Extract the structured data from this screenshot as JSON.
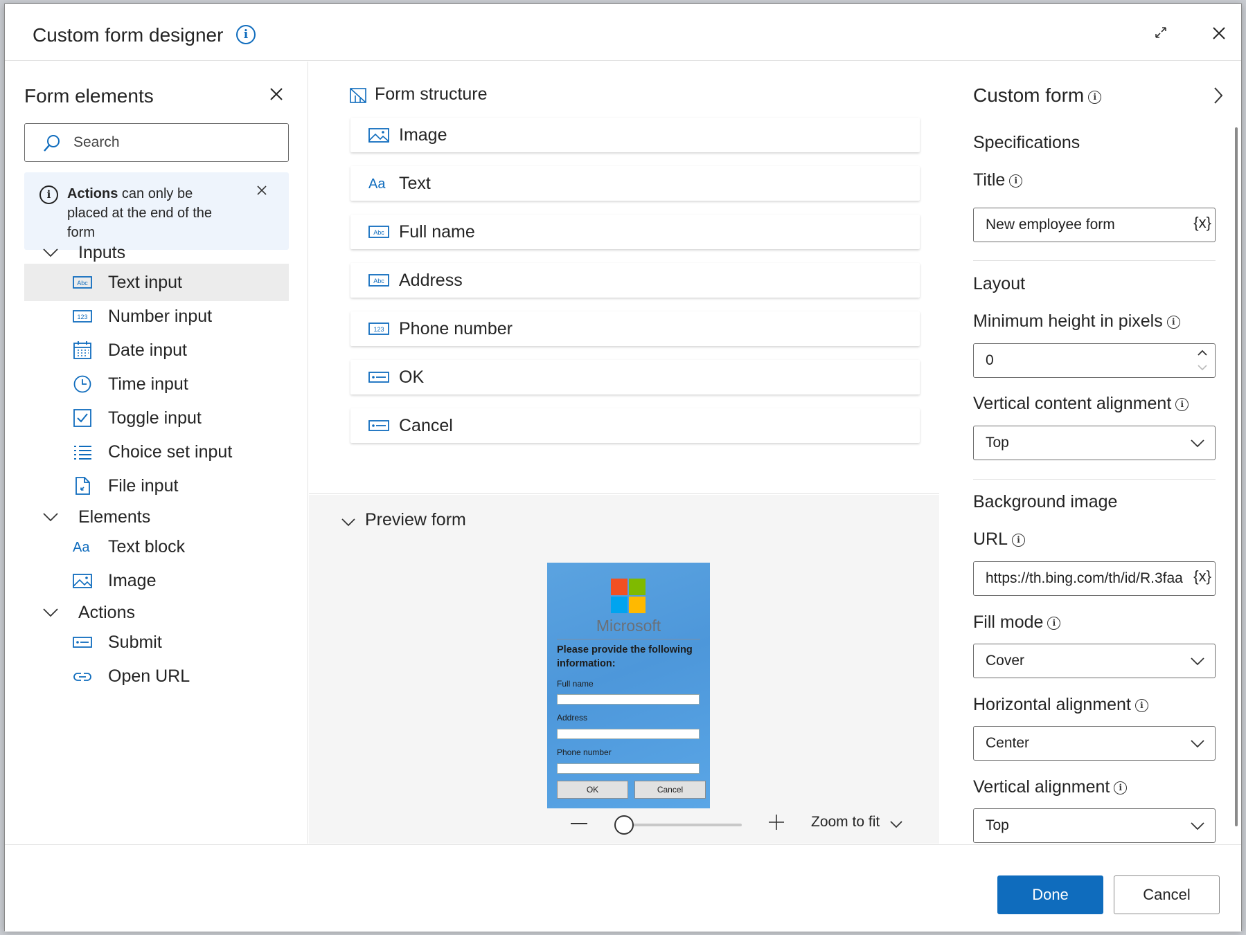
{
  "dialog": {
    "title": "Custom form designer",
    "expand_icon": "expand-icon",
    "close_icon": "close-icon"
  },
  "left_pane": {
    "title": "Form elements",
    "search_placeholder": "Search",
    "notice_bold": "Actions",
    "notice_rest": "can only be placed at the end of the form",
    "groups": {
      "inputs": {
        "label": "Inputs",
        "items": [
          "Text input",
          "Number input",
          "Date input",
          "Time input",
          "Toggle input",
          "Choice set input",
          "File input"
        ]
      },
      "elements": {
        "label": "Elements",
        "items": [
          "Text block",
          "Image"
        ]
      },
      "actions": {
        "label": "Actions",
        "items": [
          "Submit",
          "Open URL"
        ]
      }
    },
    "selected_item": "Text input"
  },
  "structure": {
    "title": "Form structure",
    "items": [
      "Image",
      "Text",
      "Full name",
      "Address",
      "Phone number",
      "OK",
      "Cancel"
    ]
  },
  "preview": {
    "title": "Preview form",
    "brand": "Microsoft",
    "heading": "Please provide the following information:",
    "labels": [
      "Full name",
      "Address",
      "Phone number"
    ],
    "ok": "OK",
    "cancel": "Cancel",
    "zoom_label": "Zoom to fit",
    "zoom_level": 0
  },
  "properties": {
    "title": "Custom form",
    "specs_heading": "Specifications",
    "title_label": "Title",
    "title_value": "New employee form",
    "variable_glyph": "{x}",
    "layout_heading": "Layout",
    "min_height_label": "Minimum height in pixels",
    "min_height_value": "0",
    "vertical_content_label": "Vertical content alignment",
    "vertical_content_value": "Top",
    "bg_heading": "Background image",
    "url_label": "URL",
    "url_value": "https://th.bing.com/th/id/R.3faa",
    "fill_mode_label": "Fill mode",
    "fill_mode_value": "Cover",
    "h_align_label": "Horizontal alignment",
    "h_align_value": "Center",
    "v_align_label": "Vertical alignment",
    "v_align_value": "Top"
  },
  "footer": {
    "done": "Done",
    "cancel": "Cancel"
  },
  "colors": {
    "accent": "#0f6cbd",
    "ms_red": "#f25022",
    "ms_green": "#7fba00",
    "ms_blue": "#00a4ef",
    "ms_yellow": "#ffb900"
  }
}
